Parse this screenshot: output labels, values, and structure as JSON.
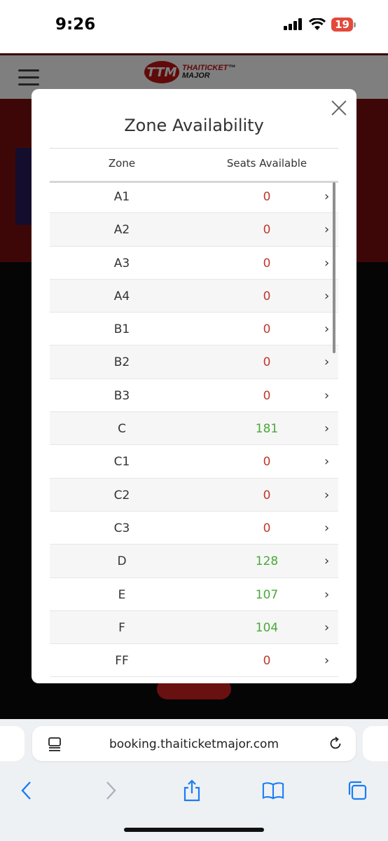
{
  "status_bar": {
    "time": "9:26",
    "battery": "19"
  },
  "site": {
    "logo_mark": "TTM",
    "logo_line1": "THAITICKET",
    "logo_line2": "MAJOR",
    "logo_tm": "™"
  },
  "modal": {
    "title": "Zone Availability",
    "columns": {
      "zone": "Zone",
      "seats": "Seats Available"
    },
    "rows": [
      {
        "zone": "A1",
        "seats": "0"
      },
      {
        "zone": "A2",
        "seats": "0"
      },
      {
        "zone": "A3",
        "seats": "0"
      },
      {
        "zone": "A4",
        "seats": "0"
      },
      {
        "zone": "B1",
        "seats": "0"
      },
      {
        "zone": "B2",
        "seats": "0"
      },
      {
        "zone": "B3",
        "seats": "0"
      },
      {
        "zone": "C",
        "seats": "181"
      },
      {
        "zone": "C1",
        "seats": "0"
      },
      {
        "zone": "C2",
        "seats": "0"
      },
      {
        "zone": "C3",
        "seats": "0"
      },
      {
        "zone": "D",
        "seats": "128"
      },
      {
        "zone": "E",
        "seats": "107"
      },
      {
        "zone": "F",
        "seats": "104"
      },
      {
        "zone": "FF",
        "seats": "0"
      }
    ],
    "chevron": "›",
    "colors": {
      "zero": "#c0392b",
      "available": "#4aa83a"
    }
  },
  "browser": {
    "url": "booking.thaiticketmajor.com",
    "icons": [
      "reader-icon",
      "reload-icon",
      "back-icon",
      "forward-icon",
      "share-icon",
      "bookmarks-icon",
      "tabs-icon"
    ]
  }
}
